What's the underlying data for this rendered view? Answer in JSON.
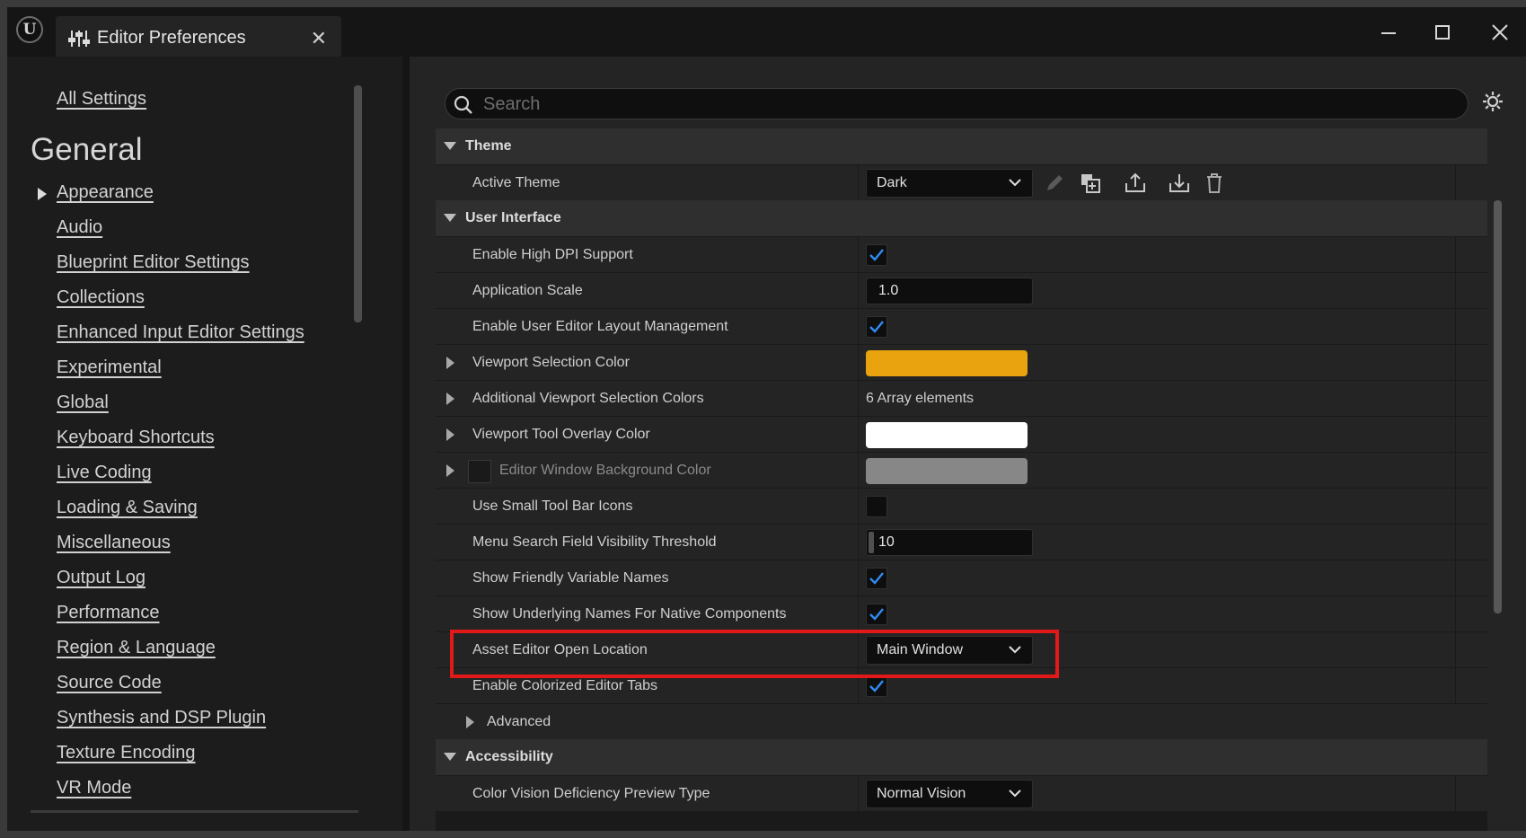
{
  "window": {
    "tab_title": "Editor Preferences",
    "controls": [
      "minimize-icon",
      "maximize-icon",
      "close-icon"
    ]
  },
  "sidebar": {
    "all_settings": "All Settings",
    "section": "General",
    "items": [
      {
        "label": "Appearance",
        "expanded_arrow": true
      },
      {
        "label": "Audio"
      },
      {
        "label": "Blueprint Editor Settings"
      },
      {
        "label": "Collections"
      },
      {
        "label": "Enhanced Input Editor Settings"
      },
      {
        "label": "Experimental"
      },
      {
        "label": "Global"
      },
      {
        "label": "Keyboard Shortcuts"
      },
      {
        "label": "Live Coding"
      },
      {
        "label": "Loading & Saving"
      },
      {
        "label": "Miscellaneous"
      },
      {
        "label": "Output Log"
      },
      {
        "label": "Performance"
      },
      {
        "label": "Region & Language"
      },
      {
        "label": "Source Code"
      },
      {
        "label": "Synthesis and DSP Plugin"
      },
      {
        "label": "Texture Encoding"
      },
      {
        "label": "VR Mode"
      }
    ]
  },
  "search": {
    "placeholder": "Search",
    "value": ""
  },
  "details": {
    "theme_category": "Theme",
    "active_theme_label": "Active Theme",
    "active_theme_value": "Dark",
    "ui_category": "User Interface",
    "high_dpi_label": "Enable High DPI Support",
    "high_dpi_checked": true,
    "app_scale_label": "Application Scale",
    "app_scale_value": "1.0",
    "layout_mgmt_label": "Enable User Editor Layout Management",
    "layout_mgmt_checked": true,
    "viewport_sel_label": "Viewport Selection Color",
    "viewport_sel_color": "#E8A30F",
    "addl_colors_label": "Additional Viewport Selection Colors",
    "addl_colors_value": "6 Array elements",
    "tool_overlay_label": "Viewport Tool Overlay Color",
    "tool_overlay_color": "#FFFFFF",
    "bg_color_label": "Editor Window Background Color",
    "bg_color": "#878787",
    "small_icons_label": "Use Small Tool Bar Icons",
    "small_icons_checked": false,
    "menu_search_label": "Menu Search Field Visibility Threshold",
    "menu_search_value": "10",
    "friendly_names_label": "Show Friendly Variable Names",
    "friendly_names_checked": true,
    "underlying_names_label": "Show Underlying Names For Native Components",
    "underlying_names_checked": true,
    "asset_editor_label": "Asset Editor Open Location",
    "asset_editor_value": "Main Window",
    "colorized_tabs_label": "Enable Colorized Editor Tabs",
    "colorized_tabs_checked": true,
    "advanced_label": "Advanced",
    "accessibility_category": "Accessibility",
    "color_vision_label": "Color Vision Deficiency Preview Type",
    "color_vision_value": "Normal Vision"
  },
  "colors": {
    "accent_check": "#2F8CF5",
    "highlight": "#E11919"
  }
}
